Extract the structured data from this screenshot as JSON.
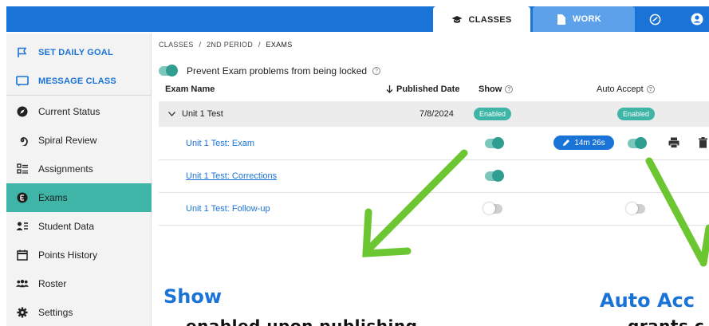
{
  "topbar": {
    "classes_label": "CLASSES",
    "work_label": "WORK"
  },
  "sidebar": {
    "items": [
      {
        "label": "SET DAILY GOAL",
        "icon": "flag-icon"
      },
      {
        "label": "MESSAGE CLASS",
        "icon": "message-icon"
      },
      {
        "label": "Current Status",
        "icon": "compass-icon"
      },
      {
        "label": "Spiral Review",
        "icon": "spiral-icon"
      },
      {
        "label": "Assignments",
        "icon": "list-icon"
      },
      {
        "label": "Exams",
        "icon": "exam-icon"
      },
      {
        "label": "Student Data",
        "icon": "student-data-icon"
      },
      {
        "label": "Points History",
        "icon": "calendar-icon"
      },
      {
        "label": "Roster",
        "icon": "roster-icon"
      },
      {
        "label": "Settings",
        "icon": "gear-icon"
      }
    ]
  },
  "breadcrumb": {
    "part1": "CLASSES",
    "part2": "2ND PERIOD",
    "current": "EXAMS",
    "sep": "/"
  },
  "prevent_lock": {
    "label": "Prevent Exam problems from being locked",
    "enabled": true
  },
  "table": {
    "headers": {
      "exam_name": "Exam Name",
      "published_date": "Published Date",
      "show": "Show",
      "auto_accept": "Auto Accept"
    },
    "group": {
      "name": "Unit 1 Test",
      "date": "7/8/2024",
      "show_badge": "Enabled",
      "auto_badge": "Enabled"
    },
    "rows": [
      {
        "name": "Unit 1 Test: Exam",
        "show": true,
        "auto_accept": true,
        "time": "14m 26s"
      },
      {
        "name": "Unit 1 Test: Corrections",
        "show": true
      },
      {
        "name": "Unit 1 Test: Follow-up",
        "show": false,
        "auto_accept": false
      }
    ]
  },
  "annotations": {
    "show_title": "Show",
    "show_sub": "enabled upon publishing",
    "auto_title": "Auto Acc",
    "auto_sub": "grants c"
  },
  "colors": {
    "primary": "#1a73d6",
    "teal": "#3fb5a8",
    "arrow": "#6cc631"
  }
}
